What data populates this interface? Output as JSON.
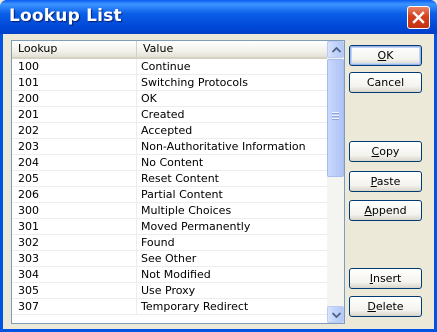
{
  "window": {
    "title": "Lookup List"
  },
  "list": {
    "columns": {
      "lookup": "Lookup",
      "value": "Value"
    },
    "rows": [
      {
        "lookup": "100",
        "value": "Continue"
      },
      {
        "lookup": "101",
        "value": "Switching Protocols"
      },
      {
        "lookup": "200",
        "value": "OK"
      },
      {
        "lookup": "201",
        "value": "Created"
      },
      {
        "lookup": "202",
        "value": "Accepted"
      },
      {
        "lookup": "203",
        "value": "Non-Authoritative Information"
      },
      {
        "lookup": "204",
        "value": "No Content"
      },
      {
        "lookup": "205",
        "value": "Reset Content"
      },
      {
        "lookup": "206",
        "value": "Partial Content"
      },
      {
        "lookup": "300",
        "value": "Multiple Choices"
      },
      {
        "lookup": "301",
        "value": "Moved Permanently"
      },
      {
        "lookup": "302",
        "value": "Found"
      },
      {
        "lookup": "303",
        "value": "See Other"
      },
      {
        "lookup": "304",
        "value": "Not Modified"
      },
      {
        "lookup": "305",
        "value": "Use Proxy"
      },
      {
        "lookup": "307",
        "value": "Temporary Redirect"
      }
    ]
  },
  "buttons": {
    "ok": {
      "accel": "O",
      "rest": "K"
    },
    "cancel": {
      "label": "Cancel"
    },
    "copy": {
      "accel": "C",
      "rest": "opy"
    },
    "paste": {
      "accel": "P",
      "rest": "aste"
    },
    "append": {
      "accel": "A",
      "rest": "ppend"
    },
    "insert": {
      "accel": "I",
      "rest": "nsert"
    },
    "delete": {
      "accel": "D",
      "rest": "elete"
    }
  },
  "icons": {
    "close": "close-icon",
    "scroll_up": "arrow-up-icon",
    "scroll_down": "arrow-down-icon"
  },
  "colors": {
    "titlebar": "#0054E3",
    "close_button": "#D5401C",
    "dialog_face": "#ECE9D8",
    "button_border": "#003C74"
  }
}
